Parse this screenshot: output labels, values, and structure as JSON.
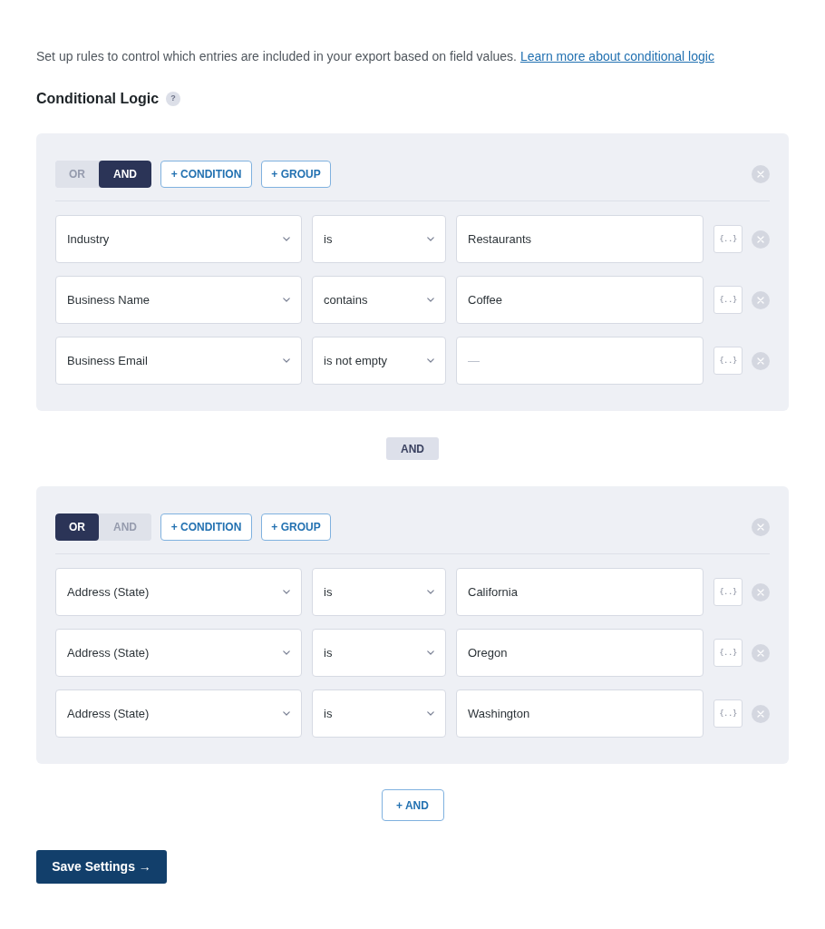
{
  "description": {
    "text": "Set up rules to control which entries are included in your export based on field values.",
    "link": "Learn more about conditional logic"
  },
  "heading": {
    "title": "Conditional Logic",
    "help": "?"
  },
  "groups": [
    {
      "operators": [
        {
          "label": "OR",
          "selected": false
        },
        {
          "label": "AND",
          "selected": true
        }
      ],
      "actions": [
        "+ CONDITION",
        "+ GROUP"
      ],
      "conditions": [
        {
          "field": "Industry",
          "operator": "is",
          "value": "Restaurants",
          "variable_button": "{..}"
        },
        {
          "field": "Business Name",
          "operator": "contains",
          "value": "Coffee",
          "variable_button": "{..}"
        },
        {
          "field": "Business Email",
          "operator": "is not empty",
          "placeholder": "—",
          "variable_button": "{..}"
        }
      ]
    },
    {
      "operators": [
        {
          "label": "OR",
          "selected": true
        },
        {
          "label": "AND",
          "selected": false
        }
      ],
      "actions": [
        "+ CONDITION",
        "+ GROUP"
      ],
      "conditions": [
        {
          "field": "Address (State)",
          "operator": "is",
          "value": "California",
          "variable_button": "{..}"
        },
        {
          "field": "Address (State)",
          "operator": "is",
          "value": "Oregon",
          "variable_button": "{..}"
        },
        {
          "field": "Address (State)",
          "operator": "is",
          "value": "Washington",
          "variable_button": "{..}"
        }
      ]
    }
  ],
  "group_joiner": "AND",
  "add_button": "+ AND",
  "save_button": "Save Settings →"
}
